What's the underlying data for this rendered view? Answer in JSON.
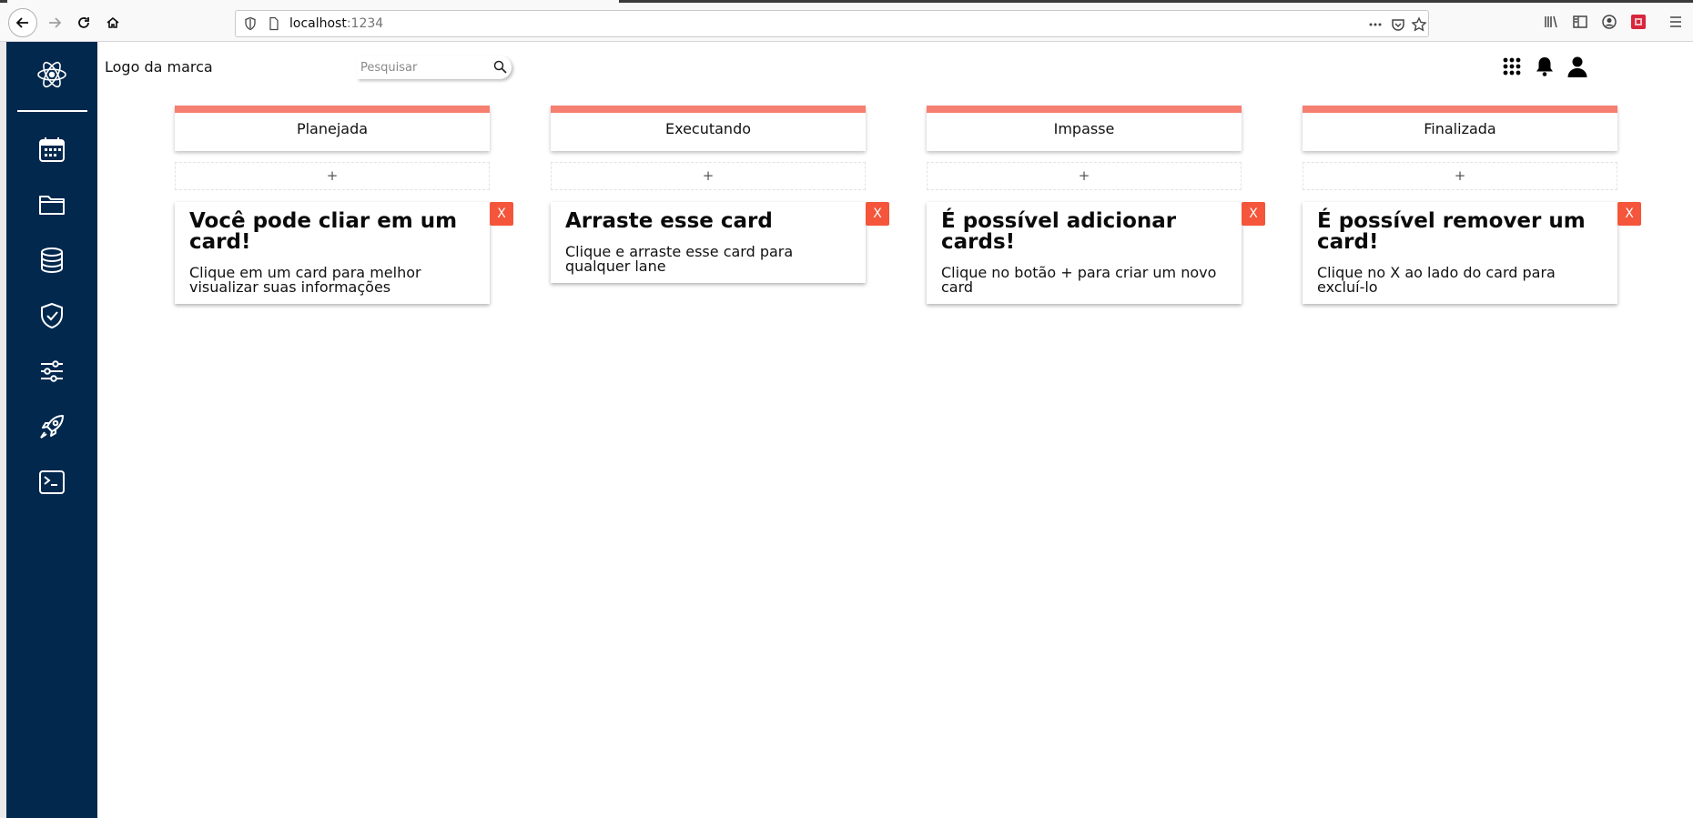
{
  "browser": {
    "url_host": "localhost",
    "url_port": ":1234"
  },
  "header": {
    "brand": "Logo da marca",
    "search_placeholder": "Pesquisar"
  },
  "sidebar": {
    "items": [
      "calendar-icon",
      "folder-icon",
      "database-icon",
      "shield-check-icon",
      "sliders-icon",
      "rocket-icon",
      "terminal-icon"
    ]
  },
  "board": {
    "add_label": "+",
    "delete_label": "X",
    "accent_color": "#f57f70",
    "delete_color": "#f4553b",
    "sidebar_color": "#02284e",
    "lanes": [
      {
        "title": "Planejada",
        "card": {
          "title": "Você pode cliar em um card!",
          "description": "Clique em um card para melhor visualizar suas informações"
        }
      },
      {
        "title": "Executando",
        "card": {
          "title": "Arraste esse card",
          "description": "Clique e arraste esse card para qualquer lane"
        }
      },
      {
        "title": "Impasse",
        "card": {
          "title": "É possível adicionar cards!",
          "description": "Clique no botão + para criar um novo card"
        }
      },
      {
        "title": "Finalizada",
        "card": {
          "title": "É possível remover um card!",
          "description": "Clique no X ao lado do card para excluí-lo"
        }
      }
    ]
  }
}
